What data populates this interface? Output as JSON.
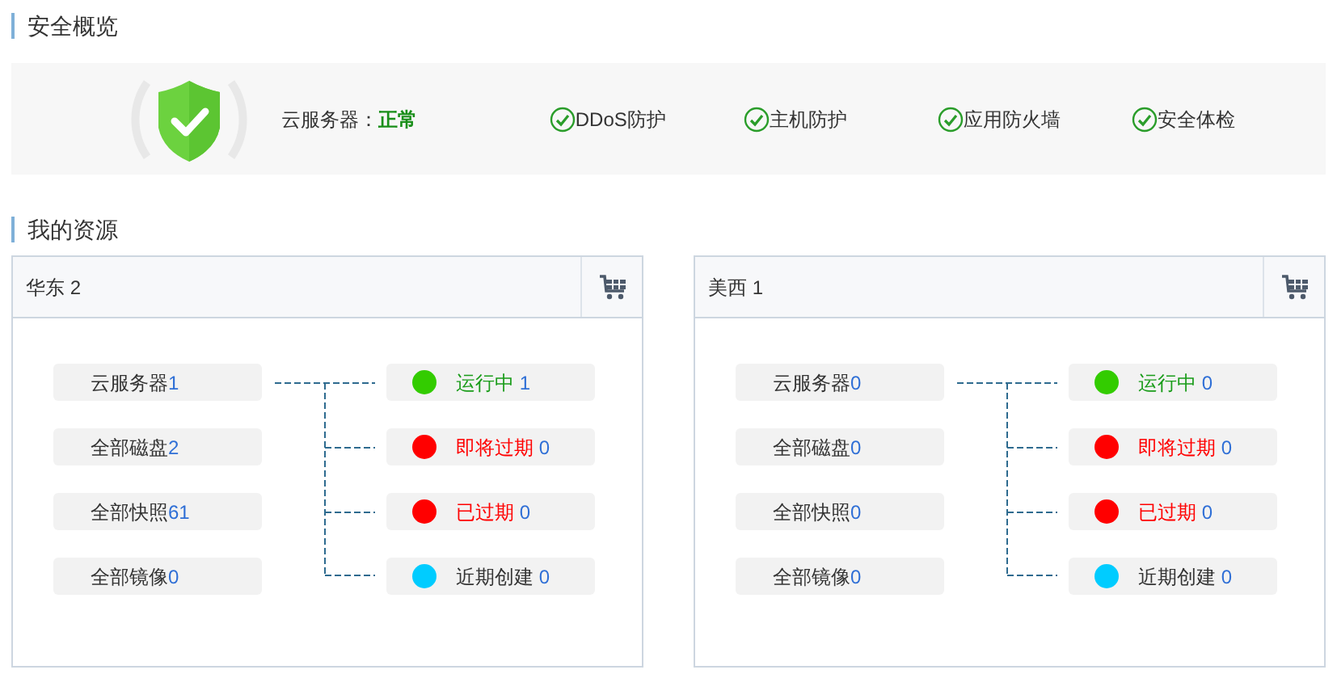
{
  "security": {
    "title": "安全概览",
    "server_label": "云服务器：",
    "server_status": "正常",
    "checks": [
      {
        "label": "DDoS防护",
        "checked": true
      },
      {
        "label": "主机防护",
        "checked": true
      },
      {
        "label": "应用防火墙",
        "checked": true
      },
      {
        "label": "安全体检",
        "checked": true
      }
    ]
  },
  "resources": {
    "title": "我的资源",
    "regions": [
      {
        "name": "华东 2",
        "resources": [
          {
            "label": "云服务器",
            "count": "1"
          },
          {
            "label": "全部磁盘",
            "count": "2"
          },
          {
            "label": "全部快照",
            "count": "61"
          },
          {
            "label": "全部镜像",
            "count": "0"
          }
        ],
        "statuses": [
          {
            "label": "运行中",
            "count": "1",
            "kind": "ok",
            "color": "#33cc00"
          },
          {
            "label": "即将过期",
            "count": "0",
            "kind": "alert",
            "color": "#ff0000"
          },
          {
            "label": "已过期",
            "count": "0",
            "kind": "alert",
            "color": "#ff0000"
          },
          {
            "label": "近期创建",
            "count": "0",
            "kind": "plain",
            "color": "#00ccff"
          }
        ]
      },
      {
        "name": "美西 1",
        "resources": [
          {
            "label": "云服务器",
            "count": "0"
          },
          {
            "label": "全部磁盘",
            "count": "0"
          },
          {
            "label": "全部快照",
            "count": "0"
          },
          {
            "label": "全部镜像",
            "count": "0"
          }
        ],
        "statuses": [
          {
            "label": "运行中",
            "count": "0",
            "kind": "ok",
            "color": "#33cc00"
          },
          {
            "label": "即将过期",
            "count": "0",
            "kind": "alert",
            "color": "#ff0000"
          },
          {
            "label": "已过期",
            "count": "0",
            "kind": "alert",
            "color": "#ff0000"
          },
          {
            "label": "近期创建",
            "count": "0",
            "kind": "plain",
            "color": "#00ccff"
          }
        ]
      }
    ]
  }
}
